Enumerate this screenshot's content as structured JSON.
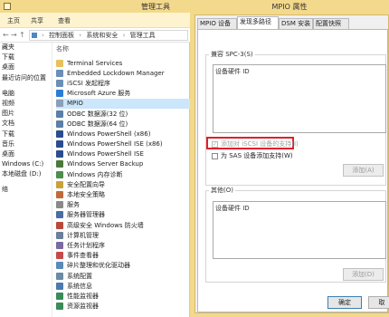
{
  "explorer": {
    "title": "管理工具",
    "ribbon_tabs": [
      "主页",
      "共享",
      "查看"
    ],
    "back_arrow": "←",
    "forward_arrow": "→",
    "up_arrow": "↑",
    "breadcrumb": [
      "控制面板",
      "系统和安全",
      "管理工具"
    ],
    "column_name": "名称",
    "nav_items": [
      {
        "label": "藏夹",
        "gap": false
      },
      {
        "label": "下载",
        "gap": false
      },
      {
        "label": "桌面",
        "gap": false
      },
      {
        "label": "最近访问的位置",
        "gap": false
      },
      {
        "label": "电脑",
        "gap": true
      },
      {
        "label": "视频",
        "gap": false
      },
      {
        "label": "图片",
        "gap": false
      },
      {
        "label": "文档",
        "gap": false
      },
      {
        "label": "下载",
        "gap": false
      },
      {
        "label": "音乐",
        "gap": false
      },
      {
        "label": "桌面",
        "gap": false
      },
      {
        "label": "Windows (C:)",
        "gap": false
      },
      {
        "label": "本地磁盘 (D:)",
        "gap": false
      },
      {
        "label": "络",
        "gap": true
      },
      {
        "label": "",
        "gap": true
      },
      {
        "label": "",
        "gap": false
      },
      {
        "label": "",
        "gap": false
      },
      {
        "label": "",
        "gap": false
      },
      {
        "label": "",
        "gap": false
      },
      {
        "label": "",
        "gap": false
      },
      {
        "label": "",
        "gap": false
      },
      {
        "label": "",
        "gap": false
      },
      {
        "label": "",
        "gap": false
      },
      {
        "label": "",
        "gap": false
      }
    ],
    "files": [
      {
        "label": "Terminal Services",
        "icon": "folder-icon",
        "color": "#e8c15a",
        "selected": false
      },
      {
        "label": "Embedded Lockdown Manager",
        "icon": "tool-icon",
        "color": "#6a8fb8",
        "selected": false
      },
      {
        "label": "iSCSI 发起程序",
        "icon": "tool-icon",
        "color": "#6a8fb8",
        "selected": false
      },
      {
        "label": "Microsoft Azure 服务",
        "icon": "cloud-icon",
        "color": "#2b7cd3",
        "selected": false
      },
      {
        "label": "MPIO",
        "icon": "tool-icon",
        "color": "#8aa0b8",
        "selected": true
      },
      {
        "label": "ODBC 数据源(32 位)",
        "icon": "database-icon",
        "color": "#5b7fa8",
        "selected": false
      },
      {
        "label": "ODBC 数据源(64 位)",
        "icon": "database-icon",
        "color": "#5b7fa8",
        "selected": false
      },
      {
        "label": "Windows PowerShell (x86)",
        "icon": "powershell-icon",
        "color": "#2a4d8f",
        "selected": false
      },
      {
        "label": "Windows PowerShell ISE (x86)",
        "icon": "powershell-icon",
        "color": "#2a4d8f",
        "selected": false
      },
      {
        "label": "Windows PowerShell ISE",
        "icon": "powershell-icon",
        "color": "#2a4d8f",
        "selected": false
      },
      {
        "label": "Windows Server Backup",
        "icon": "backup-icon",
        "color": "#4a7a3a",
        "selected": false
      },
      {
        "label": "Windows 内存诊断",
        "icon": "memory-icon",
        "color": "#4d8e4d",
        "selected": false
      },
      {
        "label": "安全配置向导",
        "icon": "shield-icon",
        "color": "#c9a23c",
        "selected": false
      },
      {
        "label": "本地安全策略",
        "icon": "policy-icon",
        "color": "#c06a3a",
        "selected": false
      },
      {
        "label": "服务",
        "icon": "gear-icon",
        "color": "#8a8a8a",
        "selected": false
      },
      {
        "label": "服务器管理器",
        "icon": "server-icon",
        "color": "#4a6ea0",
        "selected": false
      },
      {
        "label": "高级安全 Windows 防火墙",
        "icon": "firewall-icon",
        "color": "#b84a3a",
        "selected": false
      },
      {
        "label": "计算机管理",
        "icon": "computer-icon",
        "color": "#6a7f9a",
        "selected": false
      },
      {
        "label": "任务计划程序",
        "icon": "clock-icon",
        "color": "#7a6aa0",
        "selected": false
      },
      {
        "label": "事件查看器",
        "icon": "event-icon",
        "color": "#c74a4a",
        "selected": false
      },
      {
        "label": "碎片整理和优化驱动器",
        "icon": "defrag-icon",
        "color": "#5a8ab8",
        "selected": false
      },
      {
        "label": "系统配置",
        "icon": "settings-icon",
        "color": "#6a8aa8",
        "selected": false
      },
      {
        "label": "系统信息",
        "icon": "info-icon",
        "color": "#4a7ab0",
        "selected": false
      },
      {
        "label": "性能监视器",
        "icon": "monitor-icon",
        "color": "#3a8a5a",
        "selected": false
      },
      {
        "label": "资源监视器",
        "icon": "monitor-icon",
        "color": "#3a8a5a",
        "selected": false
      }
    ]
  },
  "dialog": {
    "title": "MPIO 属性",
    "tabs": [
      "MPIO 设备",
      "发现多路径",
      "DSM 安装",
      "配置快照"
    ],
    "active_tab": 1,
    "spc3_group_label": "兼容 SPC-3(S)",
    "spc3_list_header": "设备硬件 ID",
    "iscsi_checkbox_label": "添加对 iSCSI 设备的支持(I)",
    "iscsi_checked": true,
    "sas_checkbox_label": "为 SAS 设备添加支持(W)",
    "sas_checked": false,
    "add_button_top": "添加(A)",
    "other_group_label": "其他(O)",
    "other_list_header": "设备硬件 ID",
    "add_button_bottom": "添加(D)",
    "ok_button": "确定",
    "cancel_button": "取",
    "checkmark": "✓",
    "highlight_color": "#e0202a"
  }
}
